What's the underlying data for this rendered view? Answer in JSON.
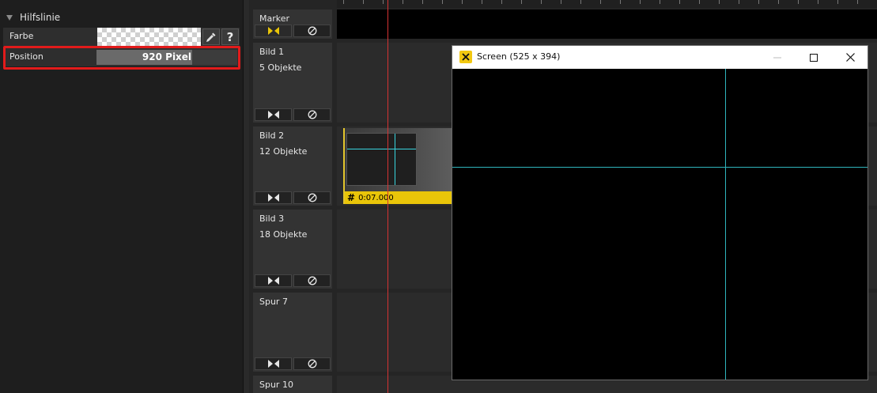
{
  "properties": {
    "section_title": "Hilfslinie",
    "farbe_label": "Farbe",
    "position_label": "Position",
    "position_value": "920 Pixel",
    "position_fill_fraction": 0.68,
    "help_label": "?"
  },
  "tracks": [
    {
      "name": "Marker",
      "count": ""
    },
    {
      "name": "Bild 1",
      "count": "5 Objekte"
    },
    {
      "name": "Bild 2",
      "count": "12 Objekte"
    },
    {
      "name": "Bild 3",
      "count": "18 Objekte"
    },
    {
      "name": "Spur 7",
      "count": ""
    },
    {
      "name": "Spur 10",
      "count": ""
    }
  ],
  "clip": {
    "time": "0:07.000"
  },
  "screen_window": {
    "title": "Screen (525 x 394)"
  },
  "colors": {
    "accent_yellow": "#e9c509",
    "highlight_red": "#e21b1b",
    "playhead_red": "#d63333",
    "guide_cyan": "#2fb5bd"
  }
}
